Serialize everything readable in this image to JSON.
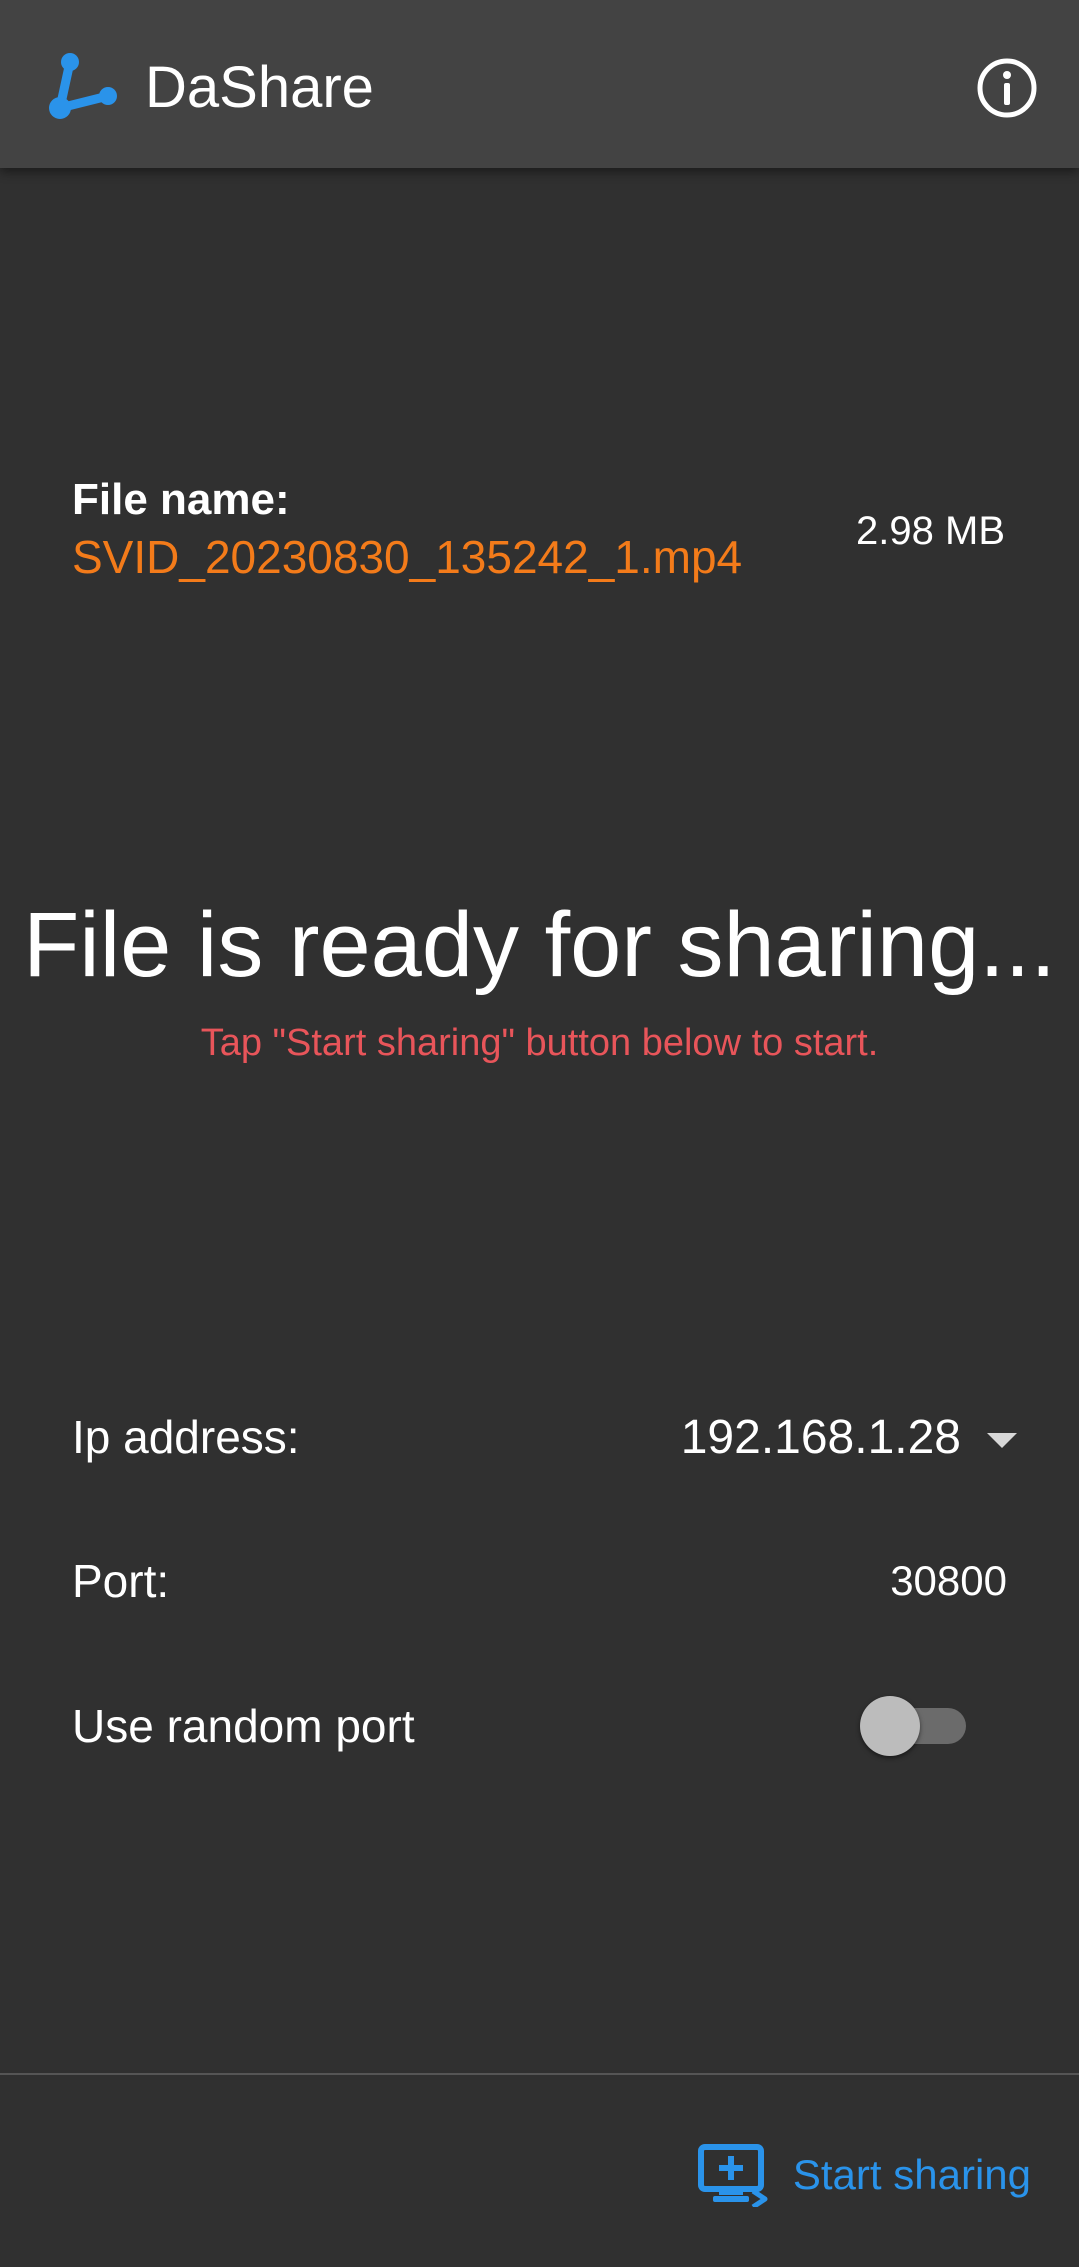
{
  "app": {
    "title": "DaShare",
    "accent_color": "#2a93ea",
    "logo_icon": "share-logo-icon",
    "info_icon": "info-icon"
  },
  "file": {
    "label": "File name:",
    "name": "SVID_20230830_135242_1.mp4",
    "size": "2.98 MB",
    "name_color": "#f37b1a"
  },
  "status": {
    "title": "File is ready for sharing...",
    "hint": "Tap \"Start sharing\" button below to start.",
    "hint_color": "#e8555a"
  },
  "settings": {
    "ip_label": "Ip address:",
    "ip_value": "192.168.1.28",
    "port_label": "Port:",
    "port_value": "30800",
    "random_port_label": "Use random port",
    "random_port_enabled": false
  },
  "actions": {
    "start_sharing_label": "Start sharing",
    "start_sharing_icon": "screen-share-add-icon"
  }
}
